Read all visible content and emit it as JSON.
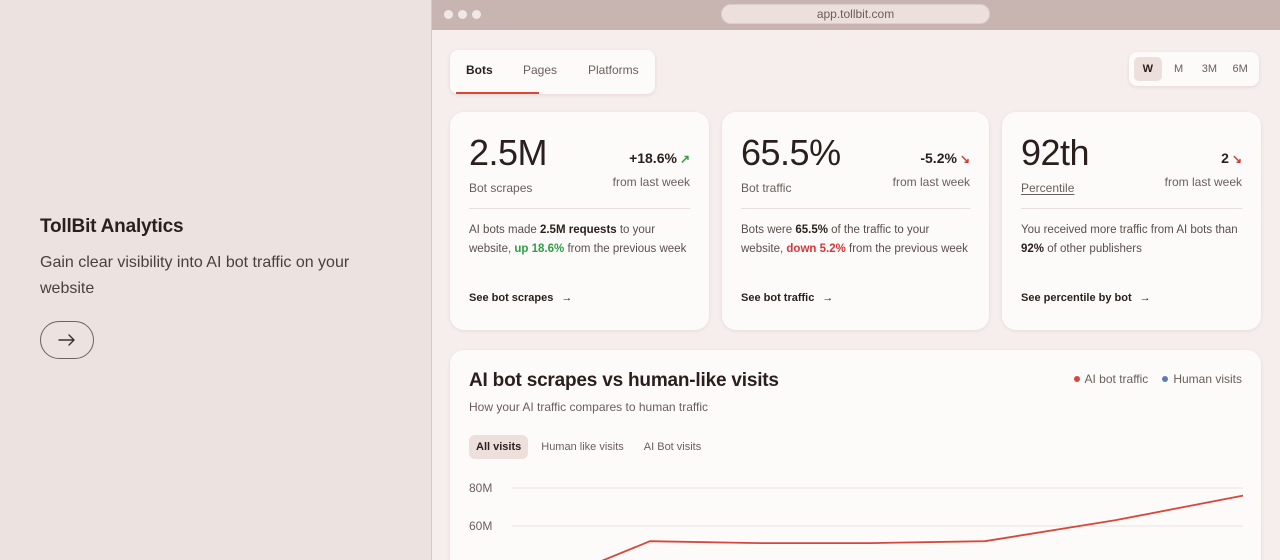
{
  "hero": {
    "title": "TollBit Analytics",
    "subtitle": "Gain clear visibility into AI bot traffic on your website",
    "button_icon": "arrow-right-icon"
  },
  "browser": {
    "url": "app.tollbit.com"
  },
  "tabs": [
    {
      "label": "Bots",
      "active": true
    },
    {
      "label": "Pages",
      "active": false
    },
    {
      "label": "Platforms",
      "active": false
    }
  ],
  "period": [
    {
      "label": "W",
      "active": true
    },
    {
      "label": "M",
      "active": false
    },
    {
      "label": "3M",
      "active": false
    },
    {
      "label": "6M",
      "active": false
    }
  ],
  "cards": {
    "scrapes": {
      "value": "2.5M",
      "change": "+18.6%",
      "label": "Bot scrapes",
      "from": "from last week",
      "desc_pre": "AI bots made ",
      "desc_bold": "2.5M requests",
      "desc_mid": " to your website, ",
      "desc_highlight": "up 18.6%",
      "desc_post": " from the previous week",
      "link": "See bot scrapes"
    },
    "traffic": {
      "value": "65.5%",
      "change": "-5.2%",
      "label": "Bot traffic",
      "from": "from last week",
      "desc_pre": "Bots were ",
      "desc_bold": "65.5%",
      "desc_mid": " of the traffic to your website, ",
      "desc_highlight": "down 5.2%",
      "desc_post": " from the previous week",
      "link": "See bot traffic"
    },
    "percentile": {
      "value": "92th",
      "change": "2",
      "label": "Percentile",
      "from": "from last week",
      "desc_pre": "You received more traffic from AI bots than ",
      "desc_bold": "92%",
      "desc_post": " of other publishers",
      "link": "See percentile by bot"
    }
  },
  "chart": {
    "title": "AI bot scrapes vs human-like visits",
    "subtitle": "How your AI traffic compares to human traffic",
    "legend": [
      {
        "label": "AI bot traffic",
        "color": "#d8473a"
      },
      {
        "label": "Human visits",
        "color": "#5b7fb0"
      }
    ],
    "filters": [
      {
        "label": "All visits",
        "active": true
      },
      {
        "label": "Human like visits",
        "active": false
      },
      {
        "label": "AI Bot visits",
        "active": false
      }
    ]
  },
  "chart_data": {
    "type": "line",
    "title": "AI bot scrapes vs human-like visits",
    "y_ticks": [
      "80M",
      "60M"
    ],
    "y_tick_values": [
      80,
      60
    ],
    "ylim": [
      0,
      80
    ],
    "grid": true,
    "legend": "top-right",
    "series": [
      {
        "name": "AI bot traffic",
        "color": "#d8473a",
        "x": [
          0,
          1,
          2,
          3,
          4,
          5,
          6
        ],
        "values": [
          37,
          52,
          51,
          51,
          52,
          63,
          76
        ]
      }
    ]
  }
}
